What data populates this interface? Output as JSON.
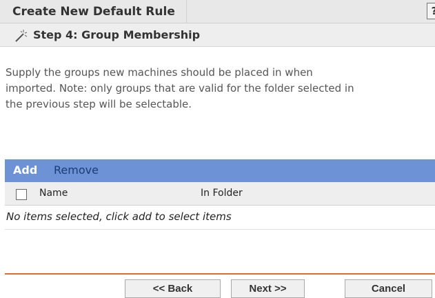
{
  "window": {
    "title": "Create New Default Rule",
    "help_label": "?"
  },
  "step": {
    "title": "Step 4: Group Membership",
    "icon": "wand-icon"
  },
  "description": {
    "lines": [
      "Supply the groups new machines should be placed in when",
      "imported. Note: only groups that are valid for the folder selected in",
      "the previous step will be selectable."
    ]
  },
  "list": {
    "toolbar": {
      "add_label": "Add",
      "remove_label": "Remove"
    },
    "columns": [
      "Name",
      "In Folder"
    ],
    "empty_message": "No items selected, click add to select items"
  },
  "buttons": {
    "back_label": "<< Back",
    "next_label": "Next >>",
    "cancel_label": "Cancel"
  },
  "colors": {
    "toolbar_bg": "#6d92d5",
    "footer_accent": "#e26a2c"
  }
}
